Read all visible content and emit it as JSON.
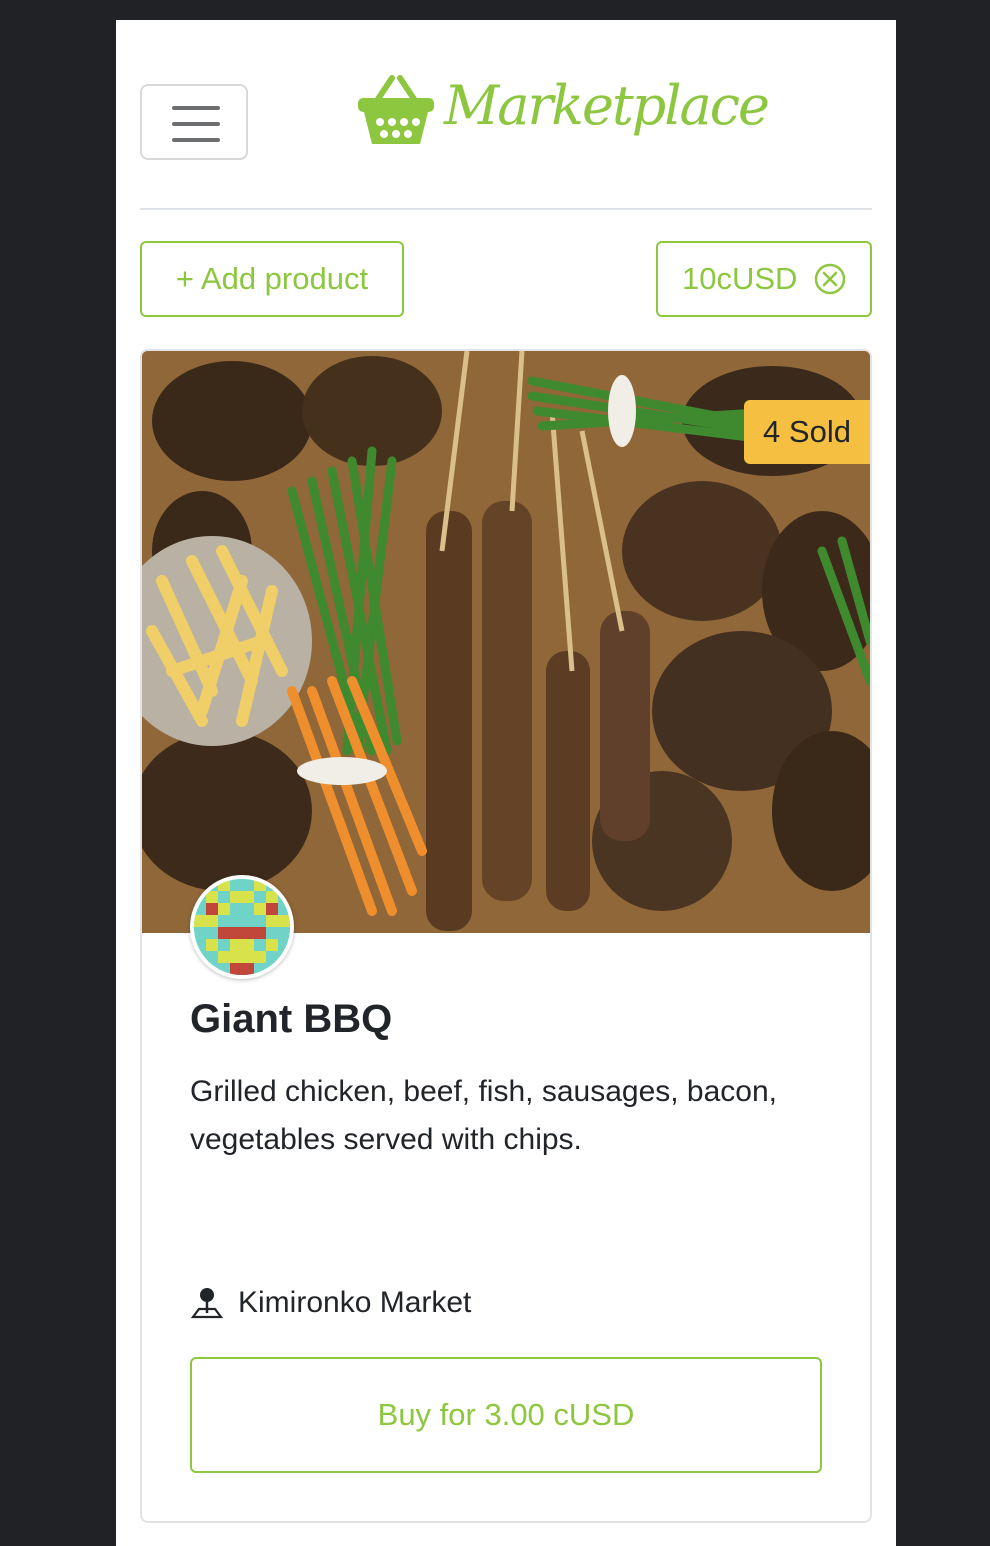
{
  "header": {
    "menu_button": "toggle-navigation",
    "logo_text": "Marketplace"
  },
  "actions": {
    "add_product_label": "+ Add product",
    "balance": "10cUSD"
  },
  "product": {
    "sold_badge": "4 Sold",
    "name": "Giant BBQ",
    "description": "Grilled chicken, beef, fish, sausages, bacon, vegetables served with chips.",
    "location": "Kimironko Market",
    "buy_label": "Buy for 3.00 cUSD"
  },
  "colors": {
    "accent": "#8dc63f",
    "badge": "#f5c042",
    "page_bg": "#212225"
  },
  "icons": [
    "hamburger-menu-icon",
    "basket-icon",
    "close-circle-icon",
    "map-pin-icon"
  ]
}
